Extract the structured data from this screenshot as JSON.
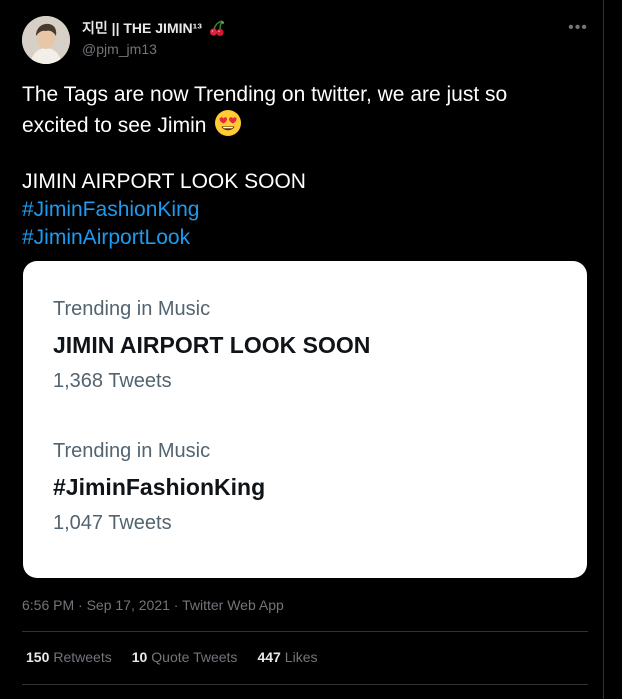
{
  "author": {
    "name": "지민 || THE JIMIN¹³",
    "handle": "@pjm_jm13",
    "avatar_icon": "avatar-photo",
    "badge_icon": "cherry-icon"
  },
  "menu": {
    "more_label": "•••",
    "more_icon": "more-horizontal-icon"
  },
  "tweet": {
    "line1": "The Tags are now Trending on twitter, we are just so",
    "line2": "excited to see Jimin",
    "emoji": "heart-eyes-emoji",
    "line3": "JIMIN AIRPORT LOOK SOON",
    "hashtag1": "#JiminFashionKing",
    "hashtag2": "#JiminAirportLook"
  },
  "trends": [
    {
      "context": "Trending in Music",
      "title": "JIMIN AIRPORT LOOK SOON",
      "count": "1,368 Tweets"
    },
    {
      "context": "Trending in Music",
      "title": "#JiminFashionKing",
      "count": "1,047 Tweets"
    }
  ],
  "meta": {
    "time": "6:56 PM",
    "separator1": " · ",
    "date": "Sep 17, 2021",
    "separator2": " · ",
    "source": "Twitter Web App"
  },
  "stats": {
    "retweets_count": "150",
    "retweets_label": "Retweets",
    "quotes_count": "10",
    "quotes_label": "Quote Tweets",
    "likes_count": "447",
    "likes_label": "Likes"
  },
  "colors": {
    "background": "#000000",
    "text": "#ffffff",
    "secondary": "#71767b",
    "link": "#1d9bf0",
    "card": "#ffffff"
  }
}
